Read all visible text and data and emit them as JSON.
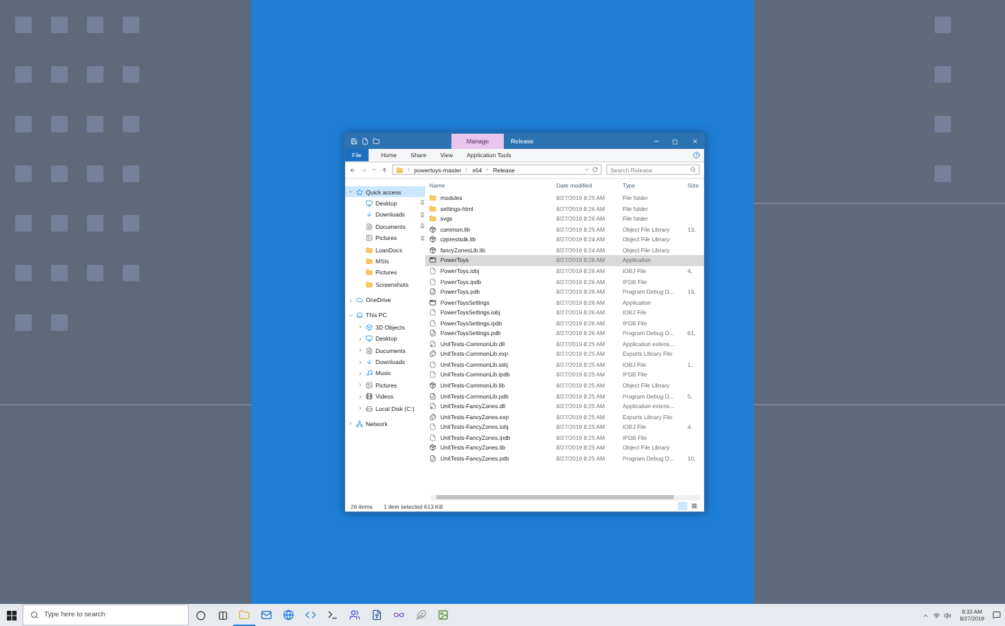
{
  "window": {
    "title": "Release",
    "context_tab": "Manage",
    "ribbon_tabs": [
      {
        "label": "File",
        "kind": "file"
      },
      {
        "label": "Home",
        "kind": "tab"
      },
      {
        "label": "Share",
        "kind": "tab"
      },
      {
        "label": "View",
        "kind": "tab"
      },
      {
        "label": "Application Tools",
        "kind": "tab"
      }
    ],
    "breadcrumb": [
      "powertoys-master",
      "x64",
      "Release"
    ],
    "search": {
      "placeholder": "Search Release"
    },
    "nav": [
      {
        "label": "Quick access",
        "kind": "quick",
        "expanded": true,
        "selected": true,
        "children": [
          {
            "label": "Desktop",
            "kind": "desktop",
            "pinned": true,
            "selected": false
          },
          {
            "label": "Downloads",
            "kind": "downloads",
            "pinned": true,
            "selected": false
          },
          {
            "label": "Documents",
            "kind": "documents",
            "pinned": true,
            "selected": false
          },
          {
            "label": "Pictures",
            "kind": "pictures",
            "pinned": true,
            "selected": false
          },
          {
            "label": "LoanDocs",
            "kind": "folder",
            "pinned": false,
            "selected": false
          },
          {
            "label": "MSIs",
            "kind": "folder",
            "pinned": false,
            "selected": false
          },
          {
            "label": "Pictures",
            "kind": "folder",
            "pinned": false,
            "selected": false
          },
          {
            "label": "Screenshots",
            "kind": "folder",
            "pinned": false,
            "selected": false
          }
        ]
      },
      {
        "label": "OneDrive",
        "kind": "cloud",
        "expanded": false,
        "selected": false
      },
      {
        "label": "This PC",
        "kind": "pc",
        "expanded": true,
        "selected": false,
        "children": [
          {
            "label": "3D Objects",
            "kind": "objects",
            "expanded": false,
            "selected": false
          },
          {
            "label": "Desktop",
            "kind": "desktop",
            "expanded": false,
            "selected": false
          },
          {
            "label": "Documents",
            "kind": "documents",
            "expanded": false,
            "selected": false
          },
          {
            "label": "Downloads",
            "kind": "downloads",
            "expanded": false,
            "selected": false
          },
          {
            "label": "Music",
            "kind": "music",
            "expanded": false,
            "selected": false
          },
          {
            "label": "Pictures",
            "kind": "pictures",
            "expanded": false,
            "selected": false
          },
          {
            "label": "Videos",
            "kind": "videos",
            "expanded": false,
            "selected": false
          },
          {
            "label": "Local Disk (C:)",
            "kind": "drive",
            "expanded": false,
            "selected": false
          }
        ]
      },
      {
        "label": "Network",
        "kind": "network",
        "expanded": false,
        "selected": false
      }
    ],
    "columns": [
      "Name",
      "Date modified",
      "Type",
      "Size"
    ],
    "rows": [
      {
        "name": "modules",
        "date": "8/27/2019 8:25 AM",
        "type": "File folder",
        "kind": "folder",
        "selected": false
      },
      {
        "name": "settings-html",
        "date": "8/27/2019 8:26 AM",
        "type": "File folder",
        "kind": "folder",
        "selected": false
      },
      {
        "name": "svgs",
        "date": "8/27/2019 8:26 AM",
        "type": "File folder",
        "kind": "folder",
        "selected": false
      },
      {
        "name": "common.lib",
        "date": "8/27/2019 8:25 AM",
        "type": "Object File Library",
        "size": "13,",
        "kind": "lib",
        "selected": false
      },
      {
        "name": "cpprestsdk.lib",
        "date": "8/27/2019 8:24 AM",
        "type": "Object File Library",
        "kind": "lib",
        "selected": false
      },
      {
        "name": "fancyZonesLib.lib",
        "date": "8/27/2019 8:24 AM",
        "type": "Object File Library",
        "kind": "lib",
        "selected": false
      },
      {
        "name": "PowerToys",
        "date": "8/27/2019 8:26 AM",
        "type": "Application",
        "kind": "app",
        "selected": true
      },
      {
        "name": "PowerToys.iobj",
        "date": "8/27/2019 8:26 AM",
        "type": "IOBJ File",
        "size": "4,",
        "kind": "file",
        "selected": false
      },
      {
        "name": "PowerToys.ipdb",
        "date": "8/27/2019 8:26 AM",
        "type": "IPDB File",
        "kind": "file",
        "selected": false
      },
      {
        "name": "PowerToys.pdb",
        "date": "8/27/2019 8:26 AM",
        "type": "Program Debug D...",
        "size": "13,",
        "kind": "pdb",
        "selected": false
      },
      {
        "name": "PowerToysSettings",
        "date": "8/27/2019 8:26 AM",
        "type": "Application",
        "kind": "app",
        "selected": false
      },
      {
        "name": "PowerToysSettings.iobj",
        "date": "8/27/2019 8:26 AM",
        "type": "IOBJ File",
        "kind": "file",
        "selected": false
      },
      {
        "name": "PowerToysSettings.ipdb",
        "date": "8/27/2019 8:26 AM",
        "type": "IPDB File",
        "kind": "file",
        "selected": false
      },
      {
        "name": "PowerToysSettings.pdb",
        "date": "8/27/2019 8:26 AM",
        "type": "Program Debug D...",
        "size": "61,",
        "kind": "pdb",
        "selected": false
      },
      {
        "name": "UnitTests-CommonLib.dll",
        "date": "8/27/2019 8:25 AM",
        "type": "Application extens...",
        "kind": "dll",
        "selected": false
      },
      {
        "name": "UnitTests-CommonLib.exp",
        "date": "8/27/2019 8:25 AM",
        "type": "Exports Library File",
        "kind": "exp",
        "selected": false
      },
      {
        "name": "UnitTests-CommonLib.iobj",
        "date": "8/27/2019 8:25 AM",
        "type": "IOBJ File",
        "size": "1,",
        "kind": "file",
        "selected": false
      },
      {
        "name": "UnitTests-CommonLib.ipdb",
        "date": "8/27/2019 8:25 AM",
        "type": "IPDB File",
        "kind": "file",
        "selected": false
      },
      {
        "name": "UnitTests-CommonLib.lib",
        "date": "8/27/2019 8:25 AM",
        "type": "Object File Library",
        "kind": "lib",
        "selected": false
      },
      {
        "name": "UnitTests-CommonLib.pdb",
        "date": "8/27/2019 8:25 AM",
        "type": "Program Debug D...",
        "size": "5,",
        "kind": "pdb",
        "selected": false
      },
      {
        "name": "UnitTests-FancyZones.dll",
        "date": "8/27/2019 8:25 AM",
        "type": "Application extens...",
        "kind": "dll",
        "selected": false
      },
      {
        "name": "UnitTests-FancyZones.exp",
        "date": "8/27/2019 8:25 AM",
        "type": "Exports Library File",
        "kind": "exp",
        "selected": false
      },
      {
        "name": "UnitTests-FancyZones.iobj",
        "date": "8/27/2019 8:25 AM",
        "type": "IOBJ File",
        "size": "4,",
        "kind": "file",
        "selected": false
      },
      {
        "name": "UnitTests-FancyZones.ipdb",
        "date": "8/27/2019 8:25 AM",
        "type": "IPDB File",
        "kind": "file",
        "selected": false
      },
      {
        "name": "UnitTests-FancyZones.lib",
        "date": "8/27/2019 8:25 AM",
        "type": "Object File Library",
        "kind": "lib",
        "selected": false
      },
      {
        "name": "UnitTests-FancyZones.pdb",
        "date": "8/27/2019 8:25 AM",
        "type": "Program Debug D...",
        "size": "10,",
        "kind": "pdb",
        "selected": false
      }
    ],
    "status": {
      "count": "26 items",
      "selection": "1 item selected  613 KB"
    }
  },
  "taskbar": {
    "search": {
      "placeholder": "Type here to search"
    },
    "time": "8:33 AM",
    "date": "8/27/2019"
  }
}
